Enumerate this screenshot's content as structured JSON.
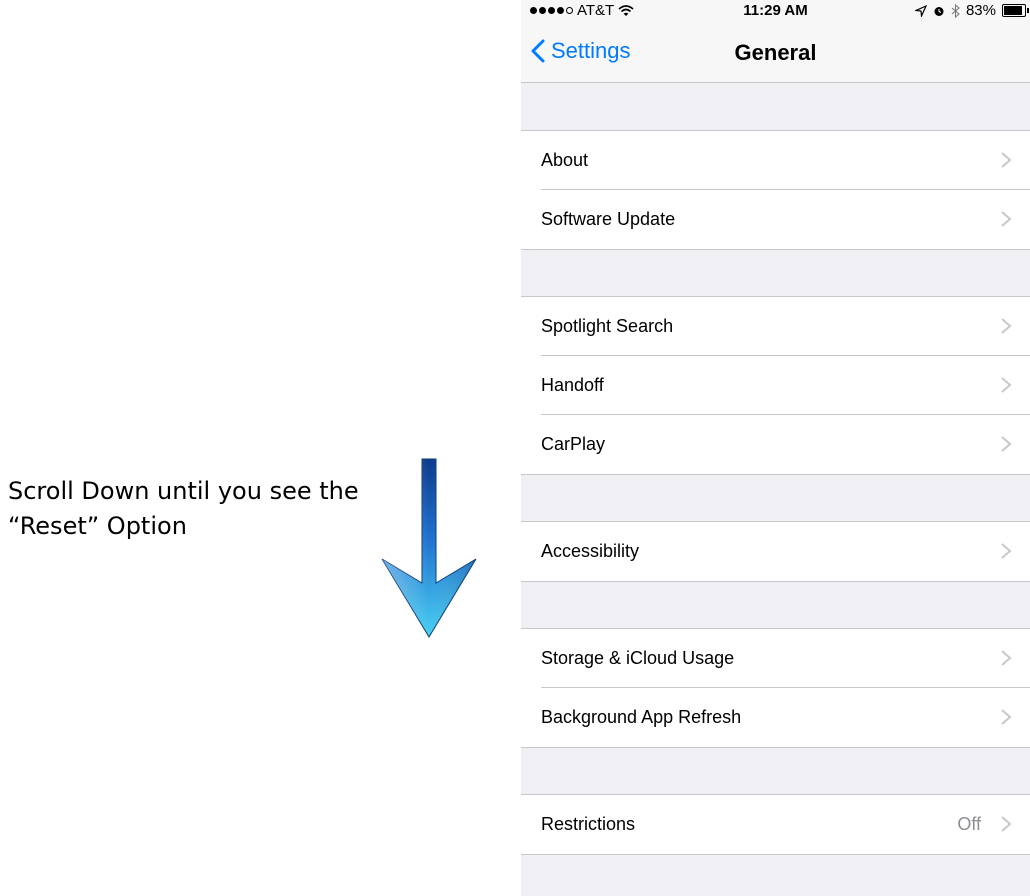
{
  "instruction": {
    "line1": "Scroll Down until you see the",
    "line2": "“Reset” Option"
  },
  "colors": {
    "accent": "#007aff",
    "page_background": "#efeff4",
    "arrow_dark": "#0d3a8c",
    "arrow_light": "#49d0f2"
  },
  "status_bar": {
    "carrier": "AT&T",
    "signal_bars": 4,
    "time": "11:29 AM",
    "battery_percent": "83%",
    "icons": [
      "wifi-icon",
      "location-icon",
      "alarm-icon",
      "bluetooth-icon",
      "battery-icon"
    ]
  },
  "nav": {
    "back_label": "Settings",
    "title": "General"
  },
  "groups": [
    {
      "items": [
        {
          "label": "About"
        },
        {
          "label": "Software Update"
        }
      ]
    },
    {
      "items": [
        {
          "label": "Spotlight Search"
        },
        {
          "label": "Handoff"
        },
        {
          "label": "CarPlay"
        }
      ]
    },
    {
      "items": [
        {
          "label": "Accessibility"
        }
      ]
    },
    {
      "items": [
        {
          "label": "Storage & iCloud Usage"
        },
        {
          "label": "Background App Refresh"
        }
      ]
    },
    {
      "items": [
        {
          "label": "Restrictions",
          "value": "Off"
        }
      ]
    }
  ]
}
